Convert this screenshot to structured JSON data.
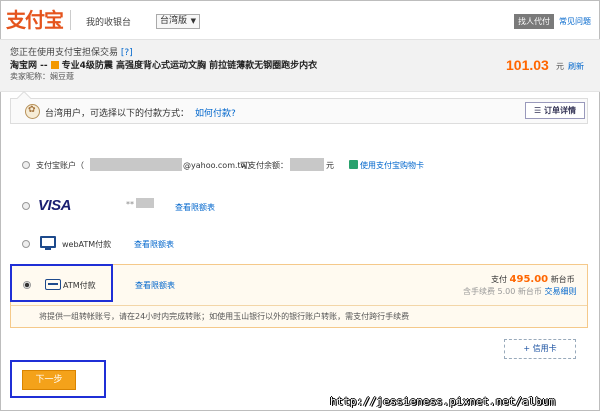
{
  "header": {
    "logo_text": "支付宝",
    "cashier_label": "我的收银台",
    "region_select": "台湾版",
    "find_pay_label": "找人代付",
    "faq_label": "常见问题"
  },
  "order": {
    "guarantee_text": "您正在使用支付宝担保交易",
    "help_mark": "[?]",
    "site_name": "淘宝网 --",
    "item_name": "专业4级防震 高强度背心式运动文胸 前拉链薄款无钢圈跑步内衣",
    "seller_label": "卖家昵称：",
    "seller_name": "娴豆蔻",
    "amount": "101.03",
    "currency": "元",
    "refresh_label": "刷新"
  },
  "instruction": {
    "text": "台湾用户，可选择以下的付款方式：",
    "how_link": "如何付款?",
    "detail_button": "☰ 订单详情"
  },
  "methods": {
    "alipay": {
      "label": "支付宝账户（",
      "email_suffix": "@yahoo.com.tw）",
      "balance_label": "可支付余额：",
      "balance_unit": "元",
      "gift_link": "使用支付宝购物卡"
    },
    "visa": {
      "brand": "VISA",
      "card_mask": "**",
      "limits_link": "查看限额表"
    },
    "webatm": {
      "label": "webATM付款",
      "limits_link": "查看限额表"
    },
    "atm": {
      "label": "ATM付款",
      "limits_link": "查看限额表",
      "pay_label": "支付",
      "pay_amount": "495.00",
      "pay_unit": "新台币",
      "fee_label": "含手续费",
      "fee_amount": "5.00",
      "fee_unit": "新台币",
      "detail_link": "交易细则",
      "note": "将提供一组转帐账号，请在24小时内完成转账；如使用玉山银行以外的银行账户转账，需支付跨行手续费"
    }
  },
  "credit_button": "+ 信用卡",
  "next_button": "下一步",
  "watermark": "http://jessieness.pixnet.net/album",
  "colors": {
    "brand": "#e5541d",
    "amount": "#ff6600",
    "link": "#0066cc",
    "highlight": "#1f2fd6",
    "next_button": "#f4a21a"
  }
}
